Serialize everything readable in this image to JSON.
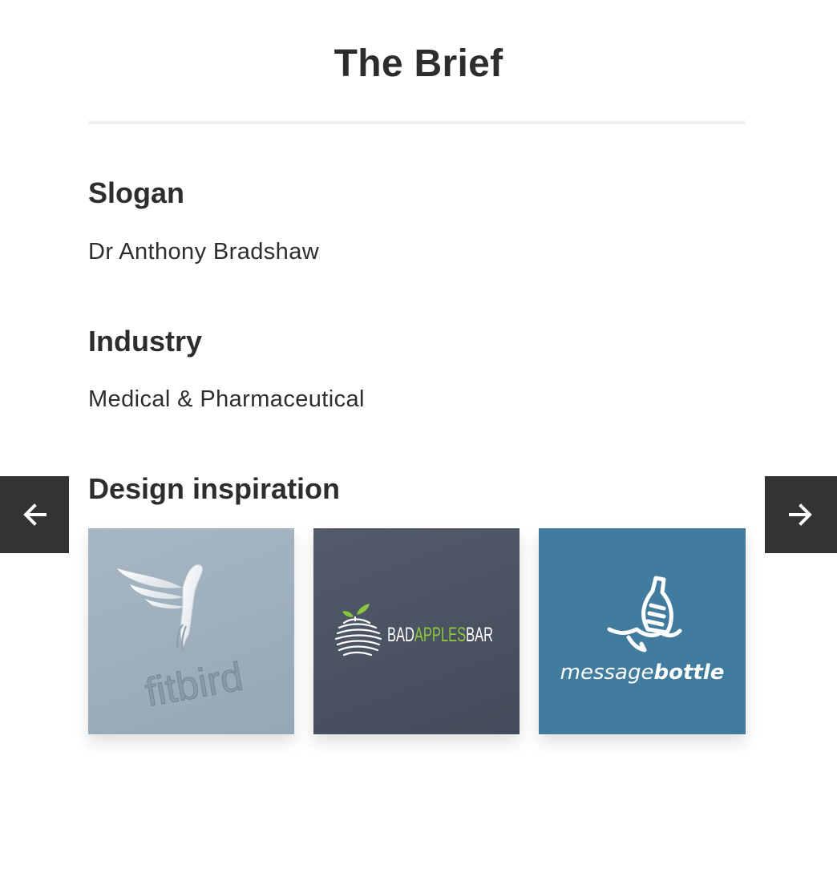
{
  "title": "The Brief",
  "slogan": {
    "heading": "Slogan",
    "value": "Dr Anthony Bradshaw"
  },
  "industry": {
    "heading": "Industry",
    "value": "Medical & Pharmaceutical"
  },
  "inspiration": {
    "heading": "Design inspiration",
    "items": [
      {
        "logo_text": "fitbird",
        "icon": "bird-logo-icon",
        "background": "#9eafbd"
      },
      {
        "logo_text_parts": [
          "BAD",
          "APPLES",
          "BAR"
        ],
        "icon": "apple-logo-icon",
        "background": "#4b5362"
      },
      {
        "logo_text_parts": [
          "message",
          "bottle"
        ],
        "icon": "bottle-logo-icon",
        "background": "#417c9f"
      }
    ]
  },
  "nav": {
    "prev_icon": "arrow-left-icon",
    "next_icon": "arrow-right-icon"
  },
  "colors": {
    "text": "#2d2d2d",
    "nav_background": "#333333",
    "apple_green": "#8dc63f"
  }
}
